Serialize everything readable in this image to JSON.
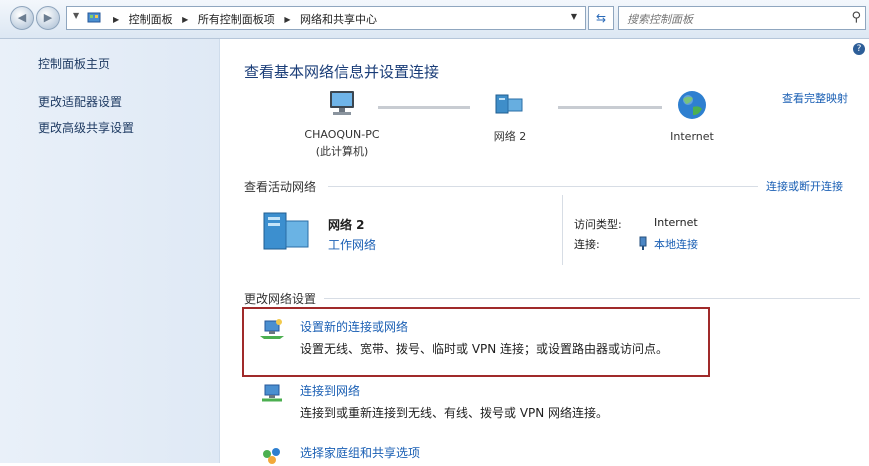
{
  "address_bar": {
    "breadcrumbs": [
      "控制面板",
      "所有控制面板项",
      "网络和共享中心"
    ],
    "search_placeholder": "搜索控制面板"
  },
  "sidebar": {
    "items": [
      {
        "label": "控制面板主页"
      },
      {
        "label": "更改适配器设置"
      },
      {
        "label": "更改高级共享设置"
      }
    ]
  },
  "main": {
    "title": "查看基本网络信息并设置连接",
    "full_map_link": "查看完整映射",
    "map": {
      "computer": {
        "name": "CHAOQUN-PC",
        "sub": "(此计算机)"
      },
      "network": {
        "name": "网络  2"
      },
      "internet": {
        "name": "Internet"
      }
    },
    "active_networks": {
      "header": "查看活动网络",
      "link": "连接或断开连接",
      "network_name": "网络  2",
      "network_type": "工作网络",
      "access_type_label": "访问类型:",
      "access_type_value": "Internet",
      "connection_label": "连接:",
      "connection_value": "本地连接"
    },
    "change_settings": {
      "header": "更改网络设置",
      "tasks": [
        {
          "link": "设置新的连接或网络",
          "desc": "设置无线、宽带、拨号、临时或 VPN 连接；或设置路由器或访问点。"
        },
        {
          "link": "连接到网络",
          "desc": "连接到或重新连接到无线、有线、拨号或 VPN 网络连接。"
        },
        {
          "link": "选择家庭组和共享选项",
          "desc": ""
        }
      ]
    }
  },
  "colors": {
    "link": "#1a5fb4",
    "title": "#1a3d78",
    "highlight_border": "#a02a2a"
  }
}
